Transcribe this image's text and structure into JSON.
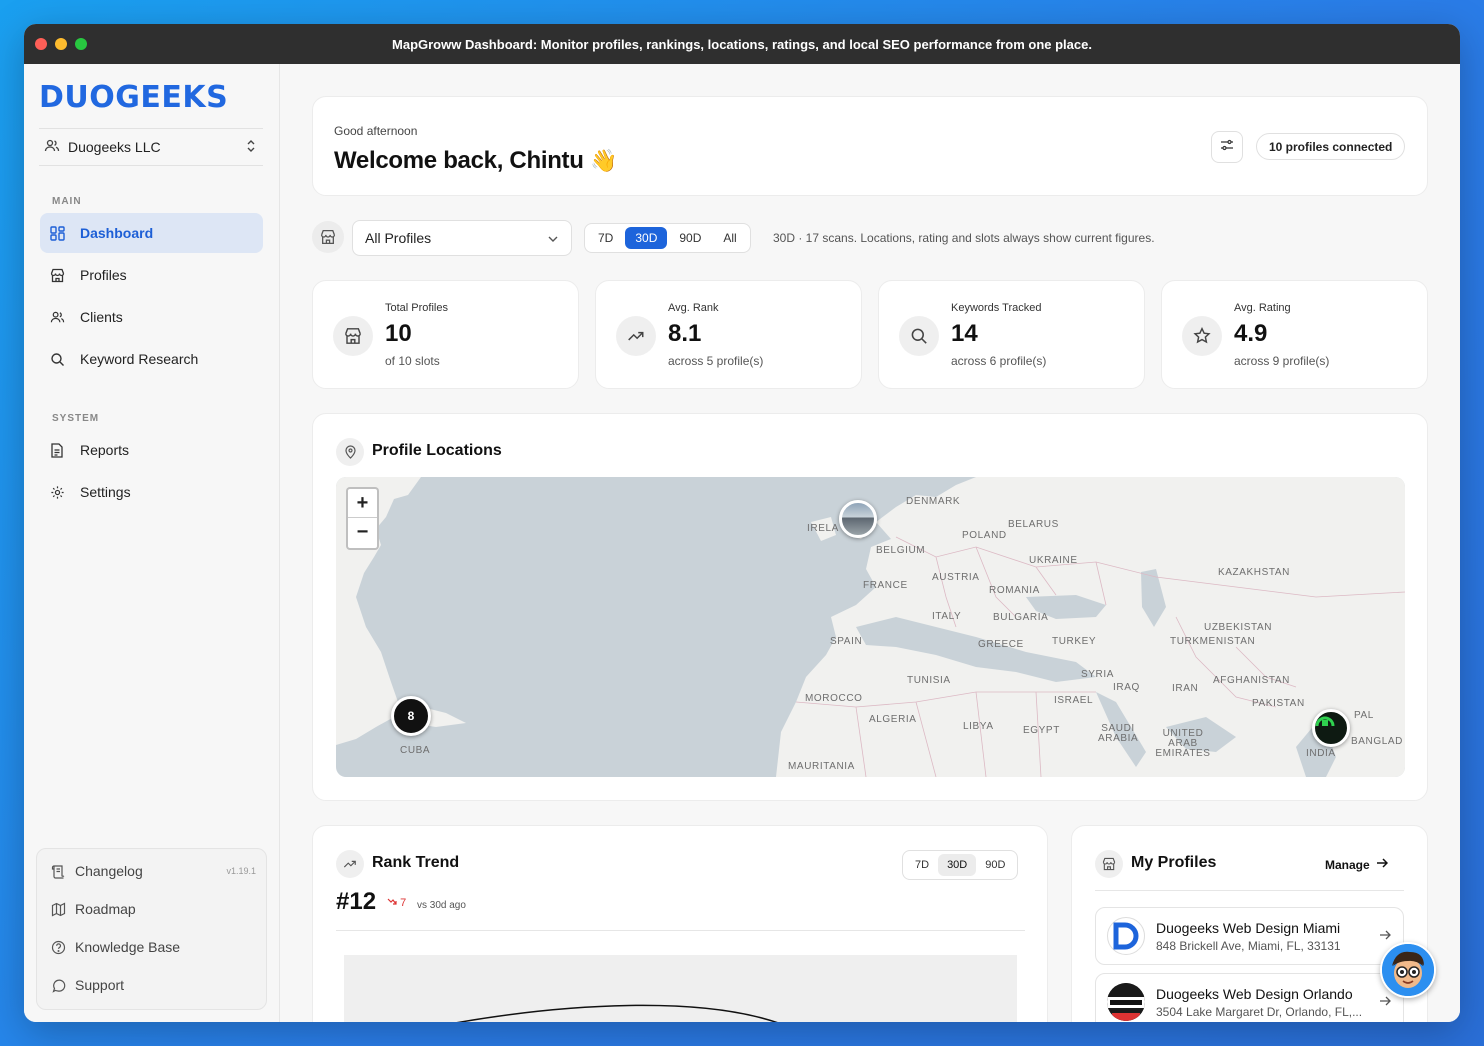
{
  "window": {
    "title": "MapGroww Dashboard: Monitor profiles, rankings, locations, ratings, and local SEO performance from one place."
  },
  "sidebar": {
    "logo": "DUOGEEKS",
    "org": "Duogeeks LLC",
    "main_label": "MAIN",
    "main_items": [
      {
        "label": "Dashboard",
        "icon": "dashboard-icon",
        "active": true
      },
      {
        "label": "Profiles",
        "icon": "store-icon"
      },
      {
        "label": "Clients",
        "icon": "users-icon"
      },
      {
        "label": "Keyword Research",
        "icon": "search-icon"
      }
    ],
    "system_label": "SYSTEM",
    "system_items": [
      {
        "label": "Reports",
        "icon": "file-icon"
      },
      {
        "label": "Settings",
        "icon": "gear-icon"
      }
    ],
    "bottom_items": [
      {
        "label": "Changelog",
        "icon": "scroll-icon",
        "version": "v1.19.1"
      },
      {
        "label": "Roadmap",
        "icon": "map-icon"
      },
      {
        "label": "Knowledge Base",
        "icon": "help-icon"
      },
      {
        "label": "Support",
        "icon": "chat-icon"
      }
    ]
  },
  "welcome": {
    "greeting": "Good afternoon",
    "headline": "Welcome back, Chintu",
    "emoji": "👋",
    "profiles_connected": "10 profiles connected"
  },
  "filters": {
    "profile_select": "All Profiles",
    "ranges": [
      "7D",
      "30D",
      "90D",
      "All"
    ],
    "active_range": "30D",
    "note": "30D · 17 scans. Locations, rating and slots always show current figures."
  },
  "stats": [
    {
      "label": "Total Profiles",
      "value": "10",
      "sub": "of 10 slots",
      "icon": "store-icon"
    },
    {
      "label": "Avg. Rank",
      "value": "8.1",
      "sub": "across 5 profile(s)",
      "icon": "trending-up-icon"
    },
    {
      "label": "Keywords Tracked",
      "value": "14",
      "sub": "across 6 profile(s)",
      "icon": "search-icon"
    },
    {
      "label": "Avg. Rating",
      "value": "4.9",
      "sub": "across 9 profile(s)",
      "icon": "star-icon"
    }
  ],
  "map": {
    "title": "Profile Locations",
    "zoom_in": "+",
    "zoom_out": "−",
    "cluster_count": "8",
    "labels": [
      "DENMARK",
      "BELARUS",
      "POLAND",
      "BELGIUM",
      "UKRAINE",
      "KAZAKHSTAN",
      "FRANCE",
      "AUSTRIA",
      "ROMANIA",
      "ITALY",
      "BULGARIA",
      "UZBEKISTAN",
      "TURKMENISTAN",
      "SPAIN",
      "GREECE",
      "TURKEY",
      "TUNISIA",
      "SYRIA",
      "IRAQ",
      "IRAN",
      "AFGHANISTAN",
      "MOROCCO",
      "ISRAEL",
      "PAKISTAN",
      "ALGERIA",
      "LIBYA",
      "EGYPT",
      "SAUDI ARABIA",
      "UNITED ARAB EMIRATES",
      "INDIA",
      "MAURITANIA",
      "CUBA",
      "IRELA",
      "PAL",
      "BANGLAD"
    ]
  },
  "rank_trend": {
    "title": "Rank Trend",
    "ranges": [
      "7D",
      "30D",
      "90D"
    ],
    "active_range": "30D",
    "rank": "#12",
    "delta": "7",
    "compare": "vs 30d ago"
  },
  "my_profiles": {
    "title": "My Profiles",
    "manage": "Manage",
    "items": [
      {
        "name": "Duogeeks Web Design Miami",
        "address": "848 Brickell Ave, Miami, FL, 33131"
      },
      {
        "name": "Duogeeks Web Design Orlando",
        "address": "3504 Lake Margaret Dr, Orlando, FL,..."
      }
    ]
  }
}
